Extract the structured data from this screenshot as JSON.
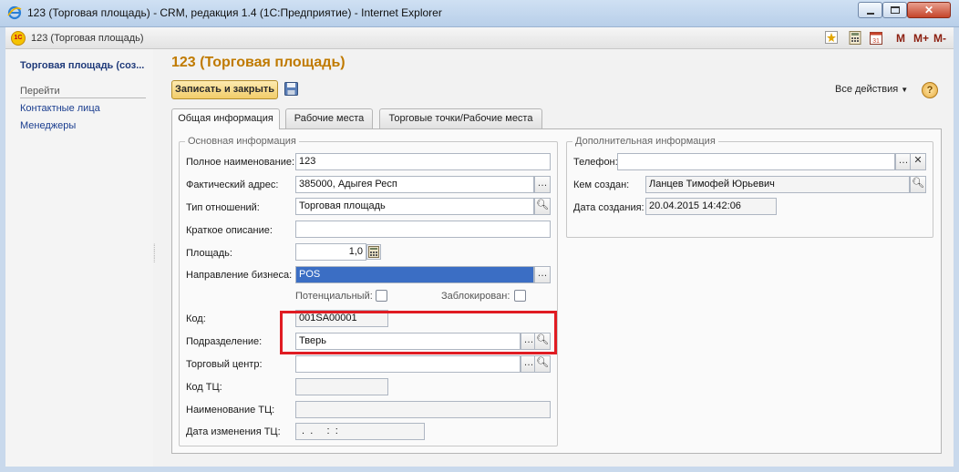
{
  "window": {
    "title": "123 (Торговая площадь) - CRM, редакция 1.4 (1С:Предприятие) - Internet Explorer",
    "doc_title": "123 (Торговая площадь)",
    "logo_text": "1C",
    "toolbar_m": [
      "M",
      "M+",
      "M-"
    ]
  },
  "sidebar": {
    "title": "Торговая площадь (соз...",
    "section": "Перейти",
    "links": [
      "Контактные лица",
      "Менеджеры"
    ]
  },
  "form": {
    "title": "123 (Торговая площадь)",
    "save_close": "Записать и закрыть",
    "all_actions": "Все действия",
    "tabs": [
      "Общая информация",
      "Рабочие места",
      "Торговые точки/Рабочие места"
    ]
  },
  "main_group": {
    "title": "Основная информация",
    "full_name_label": "Полное наименование:",
    "full_name": "123",
    "address_label": "Фактический адрес:",
    "address": "385000, Адыгея Респ",
    "relation_label": "Тип отношений:",
    "relation": "Торговая площадь",
    "short_desc_label": "Краткое описание:",
    "short_desc": "",
    "area_label": "Площадь:",
    "area": "1,0",
    "direction_label": "Направление бизнеса:",
    "direction": "POS",
    "potential_label": "Потенциальный:",
    "blocked_label": "Заблокирован:",
    "code_label": "Код:",
    "code": "001SA00001",
    "division_label": "Подразделение:",
    "division": "Тверь",
    "mall_label": "Торговый центр:",
    "mall": "",
    "mall_code_label": "Код ТЦ:",
    "mall_code": "",
    "mall_name_label": "Наименование ТЦ:",
    "mall_name": "",
    "mall_changed_label": "Дата изменения ТЦ:",
    "mall_changed": " .  .     :  :"
  },
  "extra_group": {
    "title": "Дополнительная информация",
    "phone_label": "Телефон:",
    "phone": "",
    "created_by_label": "Кем создан:",
    "created_by": "Ланцев Тимофей Юрьевич",
    "created_date_label": "Дата создания:",
    "created_date": "20.04.2015 14:42:06"
  },
  "colors": {
    "accent_title": "#c07a00",
    "highlight": "#e01b22",
    "selection": "#3b6ec4"
  }
}
